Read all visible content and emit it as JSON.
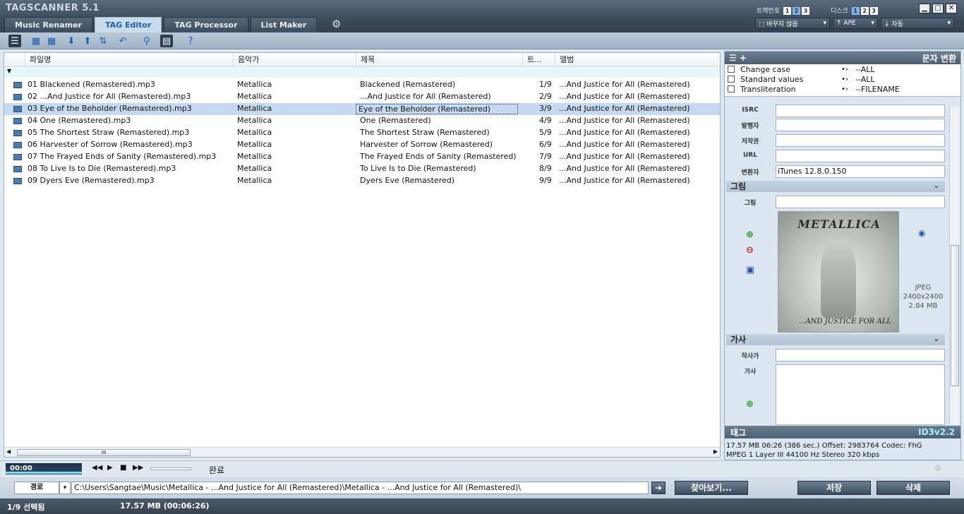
{
  "app": {
    "title": "TAGSCANNER 5.1"
  },
  "tabs": [
    "Music Renamer",
    "TAG Editor",
    "TAG Processor",
    "List Maker"
  ],
  "top": {
    "track_label": "트랙번호",
    "disc_label": "디스크",
    "nums": [
      "1",
      "2",
      "3"
    ],
    "encoding": "바꾸지 않음",
    "tagtype": "APE",
    "auto": "자동"
  },
  "table": {
    "headers": [
      "파일명",
      "음악가",
      "제목",
      "트...",
      "앨범"
    ],
    "rows": [
      {
        "file": "01 Blackened (Remastered).mp3",
        "artist": "Metallica",
        "title": "Blackened (Remastered)",
        "track": "1/9",
        "album": "...And Justice for All (Remastered)"
      },
      {
        "file": "02 ...And Justice for All (Remastered).mp3",
        "artist": "Metallica",
        "title": "...And Justice for All (Remastered)",
        "track": "2/9",
        "album": "...And Justice for All (Remastered)"
      },
      {
        "file": "03 Eye of the Beholder (Remastered).mp3",
        "artist": "Metallica",
        "title": "Eye of the Beholder (Remastered)",
        "track": "3/9",
        "album": "...And Justice for All (Remastered)"
      },
      {
        "file": "04 One (Remastered).mp3",
        "artist": "Metallica",
        "title": "One (Remastered)",
        "track": "4/9",
        "album": "...And Justice for All (Remastered)"
      },
      {
        "file": "05 The Shortest Straw (Remastered).mp3",
        "artist": "Metallica",
        "title": "The Shortest Straw (Remastered)",
        "track": "5/9",
        "album": "...And Justice for All (Remastered)"
      },
      {
        "file": "06 Harvester of Sorrow (Remastered).mp3",
        "artist": "Metallica",
        "title": "Harvester of Sorrow (Remastered)",
        "track": "6/9",
        "album": "...And Justice for All (Remastered)"
      },
      {
        "file": "07 The Frayed Ends of Sanity (Remastered).mp3",
        "artist": "Metallica",
        "title": "The Frayed Ends of Sanity (Remastered)",
        "track": "7/9",
        "album": "...And Justice for All (Remastered)"
      },
      {
        "file": "08 To Live Is to Die (Remastered).mp3",
        "artist": "Metallica",
        "title": "To Live Is to Die (Remastered)",
        "track": "8/9",
        "album": "...And Justice for All (Remastered)"
      },
      {
        "file": "09 Dyers Eve (Remastered).mp3",
        "artist": "Metallica",
        "title": "Dyers Eve (Remastered)",
        "track": "9/9",
        "album": "...And Justice for All (Remastered)"
      }
    ],
    "selected_index": 2,
    "hscroll_grip": "III"
  },
  "panel": {
    "heading": "문자 변환",
    "conversions": [
      {
        "name": "Change case",
        "value": "--ALL"
      },
      {
        "name": "Standard values",
        "value": "--ALL"
      },
      {
        "name": "Transliteration",
        "value": "--FILENAME"
      }
    ],
    "fields": [
      {
        "label": "ISRC",
        "value": ""
      },
      {
        "label": "발행자",
        "value": ""
      },
      {
        "label": "저작권",
        "value": ""
      },
      {
        "label": "URL",
        "value": ""
      },
      {
        "label": "변환자",
        "value": "iTunes 12.8.0.150"
      }
    ],
    "picture_section": "그림",
    "picture_label": "그림",
    "picture_value": "",
    "art_logo": "METALLICA",
    "art_caption": "...AND JUSTICE FOR ALL",
    "art_meta": [
      "JPEG",
      "2400x2400",
      "2.84 MB"
    ],
    "lyrics_section": "가사",
    "lyricist_label": "작사가",
    "lyricist_value": "",
    "lyrics_label": "가사",
    "lyrics_value": "",
    "tag_label": "태그",
    "tag_version": "ID3v2.2",
    "audio_line1": "17.57 MB 06:26 (386 sec.)  Offset: 2983764  Codec: FhG",
    "audio_line2": "MPEG 1 Layer III  44100 Hz  Stereo  320 kbps"
  },
  "player": {
    "time": "00:00",
    "status": "완료"
  },
  "path": {
    "label": "경로",
    "value": "C:\\Users\\Sangtae\\Music\\Metallica - ...And Justice for All (Remastered)\\Metallica - ...And Justice for All (Remastered)\\",
    "browse": "찾아보기...",
    "save": "저장",
    "delete": "삭제"
  },
  "statusbar": {
    "selected": "1/9 선택됨",
    "size": "17.57 MB (00:06:26)"
  }
}
